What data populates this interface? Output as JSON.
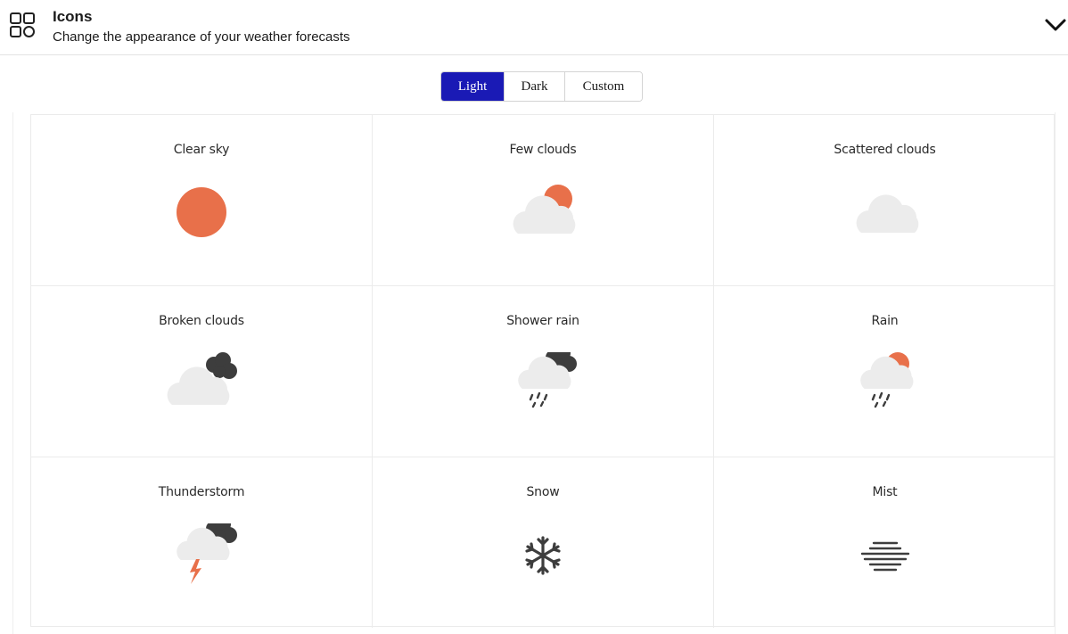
{
  "header": {
    "title": "Icons",
    "subtitle": "Change the appearance of your weather forecasts",
    "leading_icon": "grid-apps-icon",
    "trailing_icon": "chevron-down-icon"
  },
  "theme_selector": {
    "options": [
      "Light",
      "Dark",
      "Custom"
    ],
    "selected": "Light"
  },
  "colors": {
    "accent": "#1a1ab5",
    "sun": "#e8704a",
    "cloud_light": "#ececec",
    "cloud_dark": "#3d3d3d"
  },
  "weather_icons": [
    {
      "label": "Clear sky",
      "icon": "clear-sky-icon"
    },
    {
      "label": "Few clouds",
      "icon": "few-clouds-icon"
    },
    {
      "label": "Scattered clouds",
      "icon": "scattered-clouds-icon"
    },
    {
      "label": "Broken clouds",
      "icon": "broken-clouds-icon"
    },
    {
      "label": "Shower rain",
      "icon": "shower-rain-icon"
    },
    {
      "label": "Rain",
      "icon": "rain-icon"
    },
    {
      "label": "Thunderstorm",
      "icon": "thunderstorm-icon"
    },
    {
      "label": "Snow",
      "icon": "snow-icon"
    },
    {
      "label": "Mist",
      "icon": "mist-icon"
    }
  ]
}
